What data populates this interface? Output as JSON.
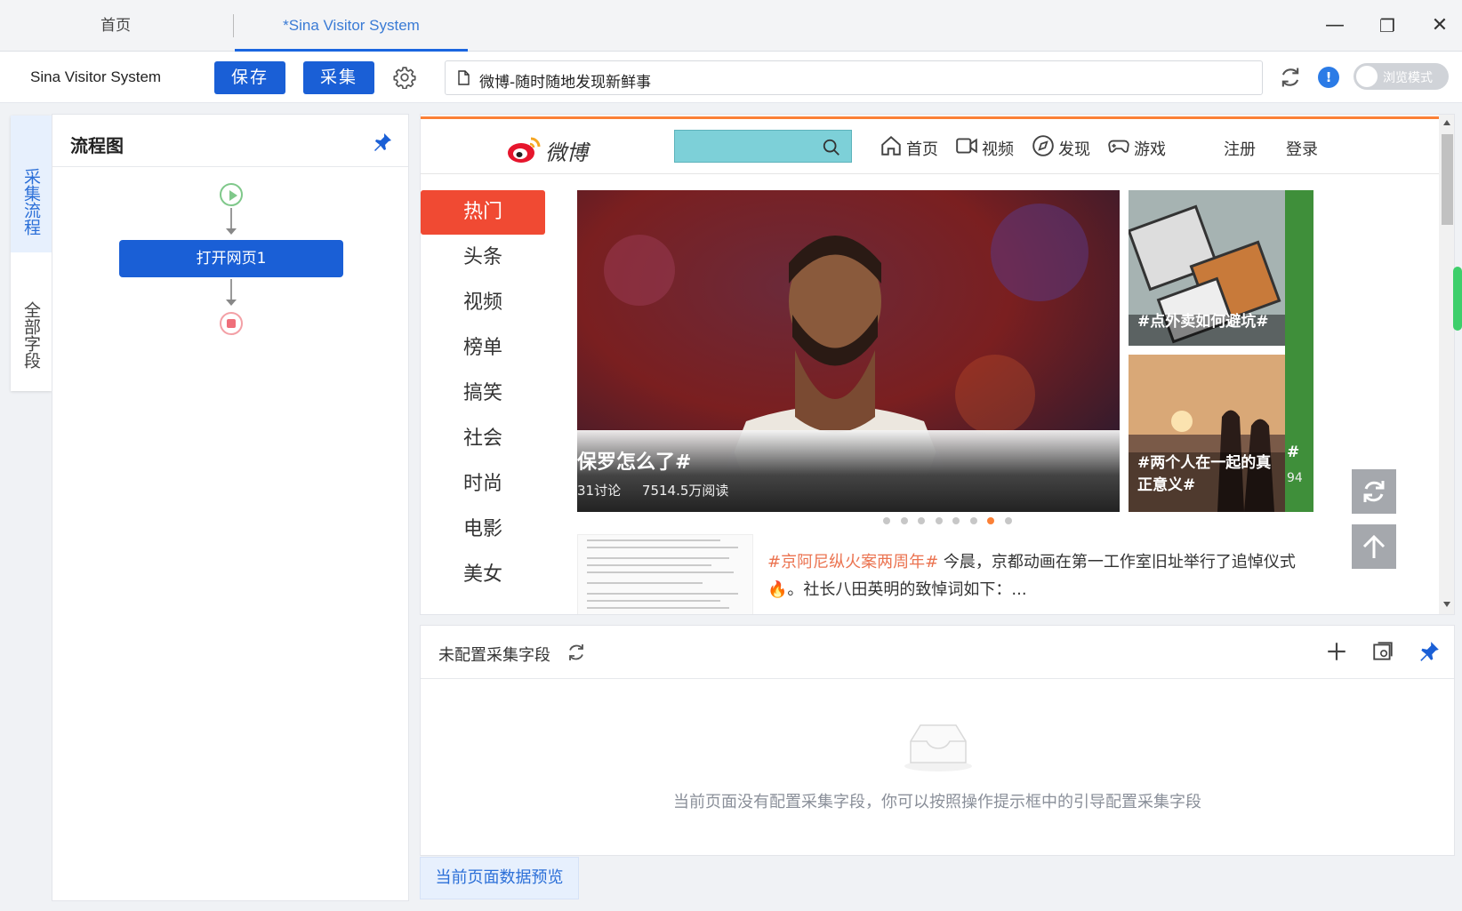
{
  "tabs": {
    "home": "首页",
    "active": "*Sina Visitor System"
  },
  "window": {
    "minimize": "—",
    "restore": "❐",
    "close": "✕"
  },
  "toolbar": {
    "app_name": "Sina Visitor System",
    "save_label": "保存",
    "collect_label": "采集",
    "url_title": "微博-随时随地发现新鲜事",
    "info_badge": "!",
    "browse_mode_label": "浏览模式"
  },
  "side_tabs": {
    "flow": "采集流程",
    "fields": "全部字段"
  },
  "flow_panel": {
    "title": "流程图",
    "open_page_node": "打开网页1"
  },
  "weibo": {
    "logo_text": "微博",
    "nav": [
      "首页",
      "视频",
      "发现",
      "游戏"
    ],
    "register": "注册",
    "login": "登录",
    "categories": [
      "热门",
      "头条",
      "视频",
      "榜单",
      "搞笑",
      "社会",
      "时尚",
      "电影",
      "美女"
    ],
    "carousel": {
      "main_title": "保罗怎么了#",
      "main_stats": "31讨论     7514.5万阅读",
      "thumb1_caption": "#点外卖如何避坑#",
      "thumb2_caption": "#两个人在一起的真正意义#",
      "thumb3_caption": "#",
      "thumb3_stats": "94",
      "dot_count": 8,
      "active_dot": 7
    },
    "news": {
      "tag": "#京阿尼纵火案两周年#",
      "text": "今晨，京都动画在第一工作室旧址举行了追悼仪式🔥。社长八田英明的致悼词如下：..."
    }
  },
  "fields_panel": {
    "title": "未配置采集字段",
    "empty_message": "当前页面没有配置采集字段，你可以按照操作提示框中的引导配置采集字段"
  },
  "bottom_tab": "当前页面数据预览",
  "colors": {
    "primary": "#1a5fd6",
    "accent": "#fb8036",
    "hot": "#f04a33",
    "link": "#2b6fd8"
  }
}
